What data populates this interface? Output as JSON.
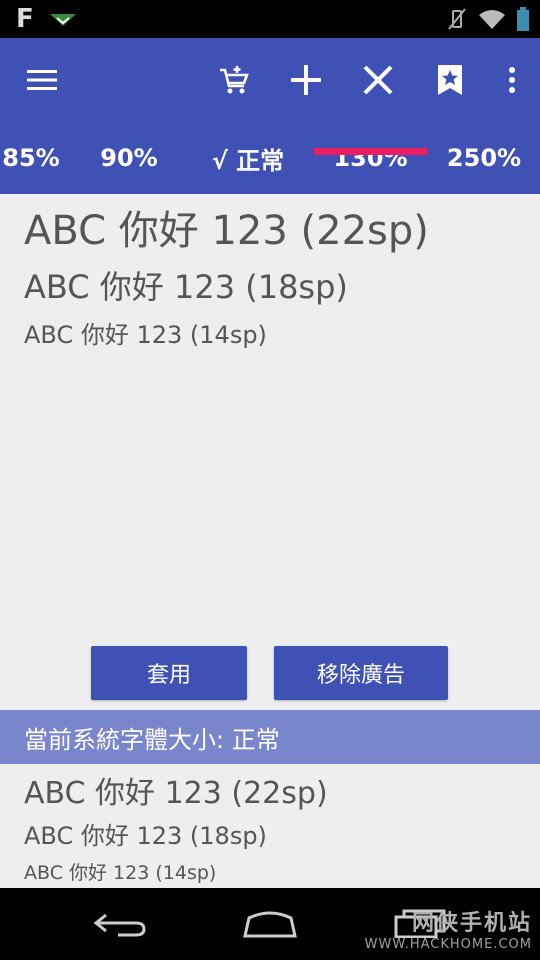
{
  "status_bar": {
    "left_letter": "F"
  },
  "toolbar": {
    "icons": [
      "menu-icon",
      "add-cart-icon",
      "plus-icon",
      "close-icon",
      "bookmark-star-icon",
      "overflow-menu-icon"
    ]
  },
  "tabs": [
    {
      "label": "85%"
    },
    {
      "label": "90%"
    },
    {
      "label": "√ 正常"
    },
    {
      "label": "130%"
    },
    {
      "label": "250%"
    }
  ],
  "selected_tab": "130%",
  "preview_top": {
    "large": "ABC 你好 123 (22sp)",
    "medium": "ABC 你好 123 (18sp)",
    "small": "ABC 你好 123 (14sp)"
  },
  "buttons": {
    "apply": "套用",
    "remove_ads": "移除廣告"
  },
  "system_banner": "當前系統字體大小: 正常",
  "preview_bottom": {
    "large": "ABC 你好 123 (22sp)",
    "medium": "ABC 你好 123 (18sp)",
    "small": "ABC 你好 123 (14sp)"
  },
  "watermark": {
    "title": "网侠手机站",
    "url": "WWW.HACKHOME.COM"
  },
  "colors": {
    "primary": "#3f51b5",
    "accent": "#e91e63",
    "banner": "#7986cb",
    "background": "#eeeeee"
  }
}
